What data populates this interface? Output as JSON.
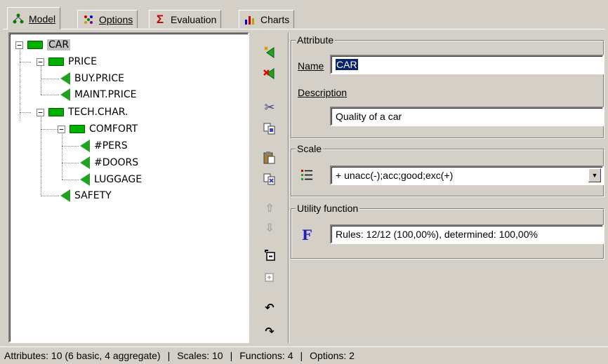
{
  "tabs": [
    {
      "label": "Model",
      "icon": "hierarchy-icon"
    },
    {
      "label": "Options",
      "icon": "options-icon"
    },
    {
      "label": "Evaluation",
      "icon": "sigma-icon"
    },
    {
      "label": "Charts",
      "icon": "chart-icon"
    }
  ],
  "tree": {
    "car": "CAR",
    "price": "PRICE",
    "buy_price": "BUY.PRICE",
    "maint_price": "MAINT.PRICE",
    "tech_char": "TECH.CHAR.",
    "comfort": "COMFORT",
    "pers": "#PERS",
    "doors": "#DOORS",
    "luggage": "LUGGAGE",
    "safety": "SAFETY"
  },
  "attribute": {
    "group_title": "Attribute",
    "name_label": "Name",
    "name_value": "CAR",
    "description_label": "Description",
    "description_value": "Quality of a car"
  },
  "scale": {
    "group_title": "Scale",
    "value": "+ unacc(-);acc;good;exc(+)"
  },
  "utility": {
    "group_title": "Utility function",
    "value": "Rules: 12/12 (100,00%), determined: 100,00%"
  },
  "status": {
    "attributes": "Attributes: 10 (6 basic, 4 aggregate)",
    "scales": "Scales: 10",
    "functions": "Functions: 4",
    "options": "Options: 2",
    "separator": "|"
  },
  "colors": {
    "aggregate_icon": "#00b000",
    "basic_icon": "#22a022",
    "selection": "#0a246a",
    "window_bg": "#d4d0c8"
  }
}
